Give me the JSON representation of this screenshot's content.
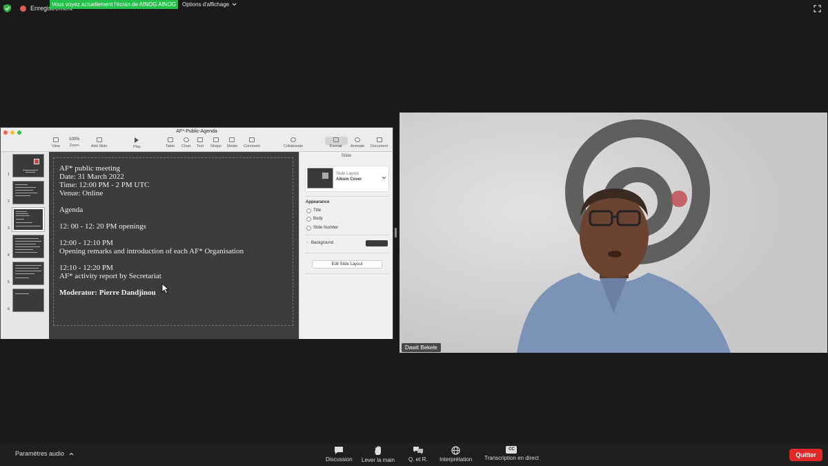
{
  "top_bar": {
    "recording_label": "Enregistrement",
    "share_banner": "Vous voyez actuellement l'écran de AfNOG AfNOG",
    "view_options": "Options d'affichage"
  },
  "keynote": {
    "doc_title": "AF*-Public-Agenda",
    "toolbar": {
      "view": "View",
      "zoom_value": "100%",
      "zoom": "Zoom",
      "add_slide": "Add Slide",
      "play": "Play",
      "table": "Table",
      "chart": "Chart",
      "text": "Text",
      "shape": "Shape",
      "media": "Media",
      "comment": "Comment",
      "collaborate": "Collaborate",
      "format": "Format",
      "animate": "Animate",
      "document": "Document"
    },
    "navigator": {
      "slide_numbers": [
        "1",
        "2",
        "3",
        "4",
        "5",
        "6"
      ],
      "selected_slide": 3
    },
    "slide_lines": {
      "l1": "AF* public meeting",
      "l2": "Date: 31 March 2022",
      "l3": "Time: 12:00 PM - 2 PM UTC",
      "l4": "Venue: Online",
      "l5": "Agenda",
      "l6": "12: 00 - 12: 20 PM openings",
      "l7": "12:00 - 12:10 PM",
      "l8": "Opening remarks and introduction of each AF* Organisation",
      "l9": "12:10 - 12:20 PM",
      "l10": "AF* activity report by Secretariat",
      "l11": "Moderator: Pierre Dandjinou"
    },
    "inspector": {
      "tab": "Slide",
      "slide_layout_label": "Slide Layout",
      "slide_layout_value": "Album Cover",
      "appearance": "Appearance",
      "title": "Title",
      "body": "Body",
      "slide_number": "Slide Number",
      "background": "Background",
      "edit_slide_layout": "Edit Slide Layout"
    }
  },
  "video": {
    "participant_name": "Dawit Bekele"
  },
  "bottom_bar": {
    "audio_settings": "Paramètres audio",
    "discussion": "Discussion",
    "raise_hand": "Lever la main",
    "qa": "Q. et R.",
    "interpretation": "Interprétation",
    "live_transcript": "Transcription en direct",
    "cc_badge": "CC",
    "quit": "Quitter"
  },
  "colors": {
    "banner_green": "#23c04a",
    "quit_red": "#e02828",
    "record_red": "#e25b54"
  },
  "icons": [
    "shield-icon",
    "record-icon",
    "chevron-down-icon",
    "fullscreen-icon",
    "chat-icon",
    "hand-icon",
    "qa-icon",
    "globe-icon",
    "cc-icon",
    "chevron-up-icon"
  ]
}
